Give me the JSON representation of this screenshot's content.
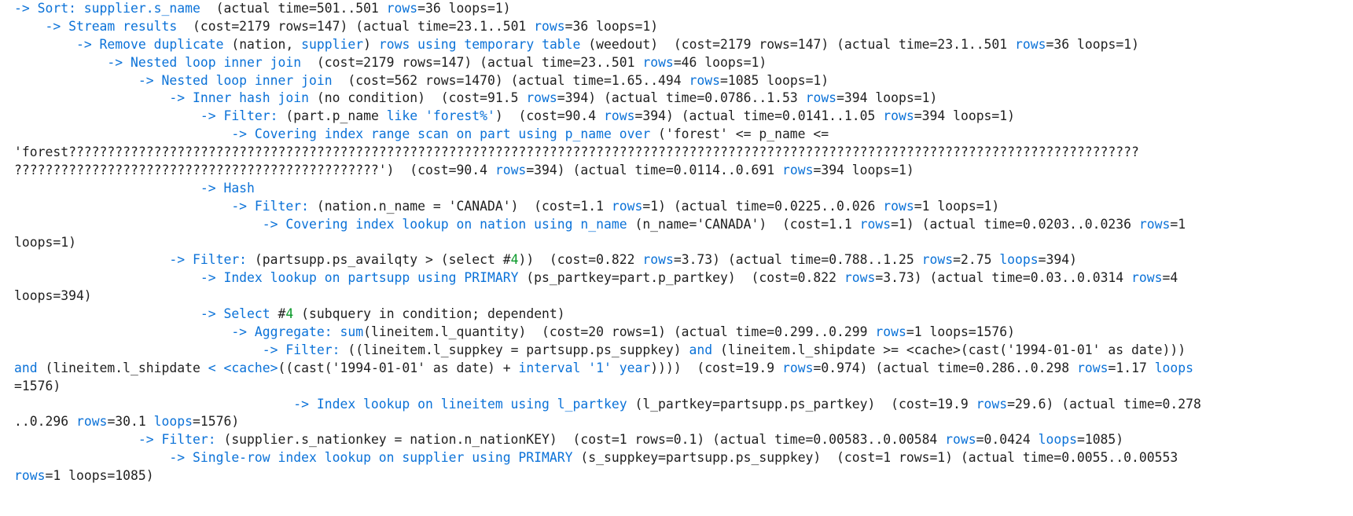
{
  "plan": {
    "lines": [
      {
        "indent": 0,
        "segments": [
          {
            "text": "-> Sort: supplier.s_name ",
            "c": "k"
          },
          {
            "text": " (actual time=501..501 "
          },
          {
            "text": "rows",
            "c": "k"
          },
          {
            "text": "=36 loops=1)"
          }
        ]
      },
      {
        "indent": 4,
        "segments": [
          {
            "text": "-> Stream results ",
            "c": "k"
          },
          {
            "text": " (cost=2179 rows=147) (actual time=23.1..501 "
          },
          {
            "text": "rows",
            "c": "k"
          },
          {
            "text": "=36 loops=1)"
          }
        ]
      },
      {
        "indent": 8,
        "segments": [
          {
            "text": "-> Remove duplicate",
            "c": "k"
          },
          {
            "text": " (nation, "
          },
          {
            "text": "supplier",
            "c": "k"
          },
          {
            "text": ") "
          },
          {
            "text": "rows using temporary table",
            "c": "k"
          },
          {
            "text": " (weedout)  (cost=2179 rows=147) (actual time=23.1..501 "
          },
          {
            "text": "rows",
            "c": "k"
          },
          {
            "text": "=36 loops=1)"
          }
        ]
      },
      {
        "indent": 12,
        "segments": [
          {
            "text": "-> Nested loop inner join ",
            "c": "k"
          },
          {
            "text": " (cost=2179 rows=147) (actual time=23..501 "
          },
          {
            "text": "rows",
            "c": "k"
          },
          {
            "text": "=46 loops=1)"
          }
        ]
      },
      {
        "indent": 16,
        "segments": [
          {
            "text": "-> Nested loop inner join ",
            "c": "k"
          },
          {
            "text": " (cost=562 rows=1470) (actual time=1.65..494 "
          },
          {
            "text": "rows",
            "c": "k"
          },
          {
            "text": "=1085 loops=1)"
          }
        ]
      },
      {
        "indent": 20,
        "segments": [
          {
            "text": "-> Inner hash join",
            "c": "k"
          },
          {
            "text": " (no condition)  (cost=91.5 "
          },
          {
            "text": "rows",
            "c": "k"
          },
          {
            "text": "=394) (actual time=0.0786..1.53 "
          },
          {
            "text": "rows",
            "c": "k"
          },
          {
            "text": "=394 loops=1)"
          }
        ]
      },
      {
        "indent": 24,
        "segments": [
          {
            "text": "-> Filter:",
            "c": "k"
          },
          {
            "text": " (part.p_name "
          },
          {
            "text": "like 'forest%'",
            "c": "k"
          },
          {
            "text": ")  (cost=90.4 "
          },
          {
            "text": "rows",
            "c": "k"
          },
          {
            "text": "=394) (actual time=0.0141..1.05 "
          },
          {
            "text": "rows",
            "c": "k"
          },
          {
            "text": "=394 loops=1)"
          }
        ]
      },
      {
        "indent": 28,
        "segments": [
          {
            "text": "-> Covering index range scan on part using p_name over",
            "c": "k"
          },
          {
            "text": " ('forest' <= p_name <="
          }
        ]
      },
      {
        "indent": 0,
        "segments": [
          {
            "text": "'forest??????????????????????????????????????????????????????????????????????????????????????????????????????????????????????????????????????????"
          }
        ]
      },
      {
        "indent": 0,
        "segments": [
          {
            "text": "???????????????????????????????????????????????')  (cost=90.4 "
          },
          {
            "text": "rows",
            "c": "k"
          },
          {
            "text": "=394) (actual time=0.0114..0.691 "
          },
          {
            "text": "rows",
            "c": "k"
          },
          {
            "text": "=394 loops=1)"
          }
        ]
      },
      {
        "indent": 24,
        "segments": [
          {
            "text": "-> Hash",
            "c": "k"
          }
        ]
      },
      {
        "indent": 28,
        "segments": [
          {
            "text": "-> Filter:",
            "c": "k"
          },
          {
            "text": " (nation.n_name = 'CANADA')  (cost=1.1 "
          },
          {
            "text": "rows",
            "c": "k"
          },
          {
            "text": "=1) (actual time=0.0225..0.026 "
          },
          {
            "text": "rows",
            "c": "k"
          },
          {
            "text": "=1 loops=1)"
          }
        ]
      },
      {
        "indent": 32,
        "segments": [
          {
            "text": "-> Covering index lookup on nation using n_name",
            "c": "k"
          },
          {
            "text": " (n_name='CANADA')  (cost=1.1 "
          },
          {
            "text": "rows",
            "c": "k"
          },
          {
            "text": "=1) (actual time=0.0203..0.0236 "
          },
          {
            "text": "rows",
            "c": "k"
          },
          {
            "text": "=1"
          }
        ]
      },
      {
        "indent": 0,
        "segments": [
          {
            "text": "loops=1)"
          }
        ]
      },
      {
        "indent": 20,
        "segments": [
          {
            "text": "-> Filter:",
            "c": "k"
          },
          {
            "text": " (partsupp.ps_availqty > (select #"
          },
          {
            "text": "4",
            "c": "g"
          },
          {
            "text": "))  (cost=0.822 "
          },
          {
            "text": "rows",
            "c": "k"
          },
          {
            "text": "=3.73) (actual time=0.788..1.25 "
          },
          {
            "text": "rows",
            "c": "k"
          },
          {
            "text": "=2.75 "
          },
          {
            "text": "loops",
            "c": "k"
          },
          {
            "text": "=394)"
          }
        ]
      },
      {
        "indent": 24,
        "segments": [
          {
            "text": "-> Index lookup on partsupp using PRIMARY",
            "c": "k"
          },
          {
            "text": " (ps_partkey=part.p_partkey)  (cost=0.822 "
          },
          {
            "text": "rows",
            "c": "k"
          },
          {
            "text": "=3.73) (actual time=0.03..0.0314 "
          },
          {
            "text": "rows",
            "c": "k"
          },
          {
            "text": "=4"
          }
        ]
      },
      {
        "indent": 0,
        "segments": [
          {
            "text": "loops=394)"
          }
        ]
      },
      {
        "indent": 24,
        "segments": [
          {
            "text": "-> Select",
            "c": "k"
          },
          {
            "text": " #"
          },
          {
            "text": "4",
            "c": "g"
          },
          {
            "text": " (subquery in condition; dependent)"
          }
        ]
      },
      {
        "indent": 28,
        "segments": [
          {
            "text": "-> Aggregate:",
            "c": "k"
          },
          {
            "text": " "
          },
          {
            "text": "sum",
            "c": "k"
          },
          {
            "text": "(lineitem.l_quantity)  (cost=20 rows=1) (actual time=0.299..0.299 "
          },
          {
            "text": "rows",
            "c": "k"
          },
          {
            "text": "=1 loops=1576)"
          }
        ]
      },
      {
        "indent": 32,
        "segments": [
          {
            "text": "-> Filter:",
            "c": "k"
          },
          {
            "text": " ((lineitem.l_suppkey = partsupp.ps_suppkey) "
          },
          {
            "text": "and",
            "c": "k"
          },
          {
            "text": " (lineitem.l_shipdate >= <cache>(cast('1994-01-01' as date)))"
          }
        ]
      },
      {
        "indent": 0,
        "segments": [
          {
            "text": "and",
            "c": "k"
          },
          {
            "text": " (lineitem.l_shipdate "
          },
          {
            "text": "< <cache>",
            "c": "k"
          },
          {
            "text": "((cast('1994-01-01' as date) + "
          },
          {
            "text": "interval '1' year",
            "c": "k"
          },
          {
            "text": "))))  (cost=19.9 "
          },
          {
            "text": "rows",
            "c": "k"
          },
          {
            "text": "=0.974) (actual time=0.286..0.298 "
          },
          {
            "text": "rows",
            "c": "k"
          },
          {
            "text": "=1.17 "
          },
          {
            "text": "loops",
            "c": "k"
          }
        ]
      },
      {
        "indent": 0,
        "segments": [
          {
            "text": "=1576)"
          }
        ]
      },
      {
        "indent": 36,
        "segments": [
          {
            "text": "-> Index lookup on lineitem using l_partkey",
            "c": "k"
          },
          {
            "text": " (l_partkey=partsupp.ps_partkey)  (cost=19.9 "
          },
          {
            "text": "rows",
            "c": "k"
          },
          {
            "text": "=29.6) (actual time=0.278"
          }
        ]
      },
      {
        "indent": 0,
        "segments": [
          {
            "text": "..0.296 "
          },
          {
            "text": "rows",
            "c": "k"
          },
          {
            "text": "=30.1 "
          },
          {
            "text": "loops",
            "c": "k"
          },
          {
            "text": "=1576)"
          }
        ]
      },
      {
        "indent": 16,
        "segments": [
          {
            "text": "-> Filter:",
            "c": "k"
          },
          {
            "text": " (supplier.s_nationkey = nation.n_nationKEY)  (cost=1 rows=0.1) (actual time=0.00583..0.00584 "
          },
          {
            "text": "rows",
            "c": "k"
          },
          {
            "text": "=0.0424 "
          },
          {
            "text": "loops",
            "c": "k"
          },
          {
            "text": "=1085)"
          }
        ]
      },
      {
        "indent": 20,
        "segments": [
          {
            "text": "-> Single-row index lookup on supplier using PRIMARY",
            "c": "k"
          },
          {
            "text": " (s_suppkey=partsupp.ps_suppkey)  (cost=1 rows=1) (actual time=0.0055..0.00553"
          }
        ]
      },
      {
        "indent": 0,
        "segments": [
          {
            "text": "rows",
            "c": "k"
          },
          {
            "text": "=1 loops=1085)"
          }
        ]
      }
    ]
  }
}
